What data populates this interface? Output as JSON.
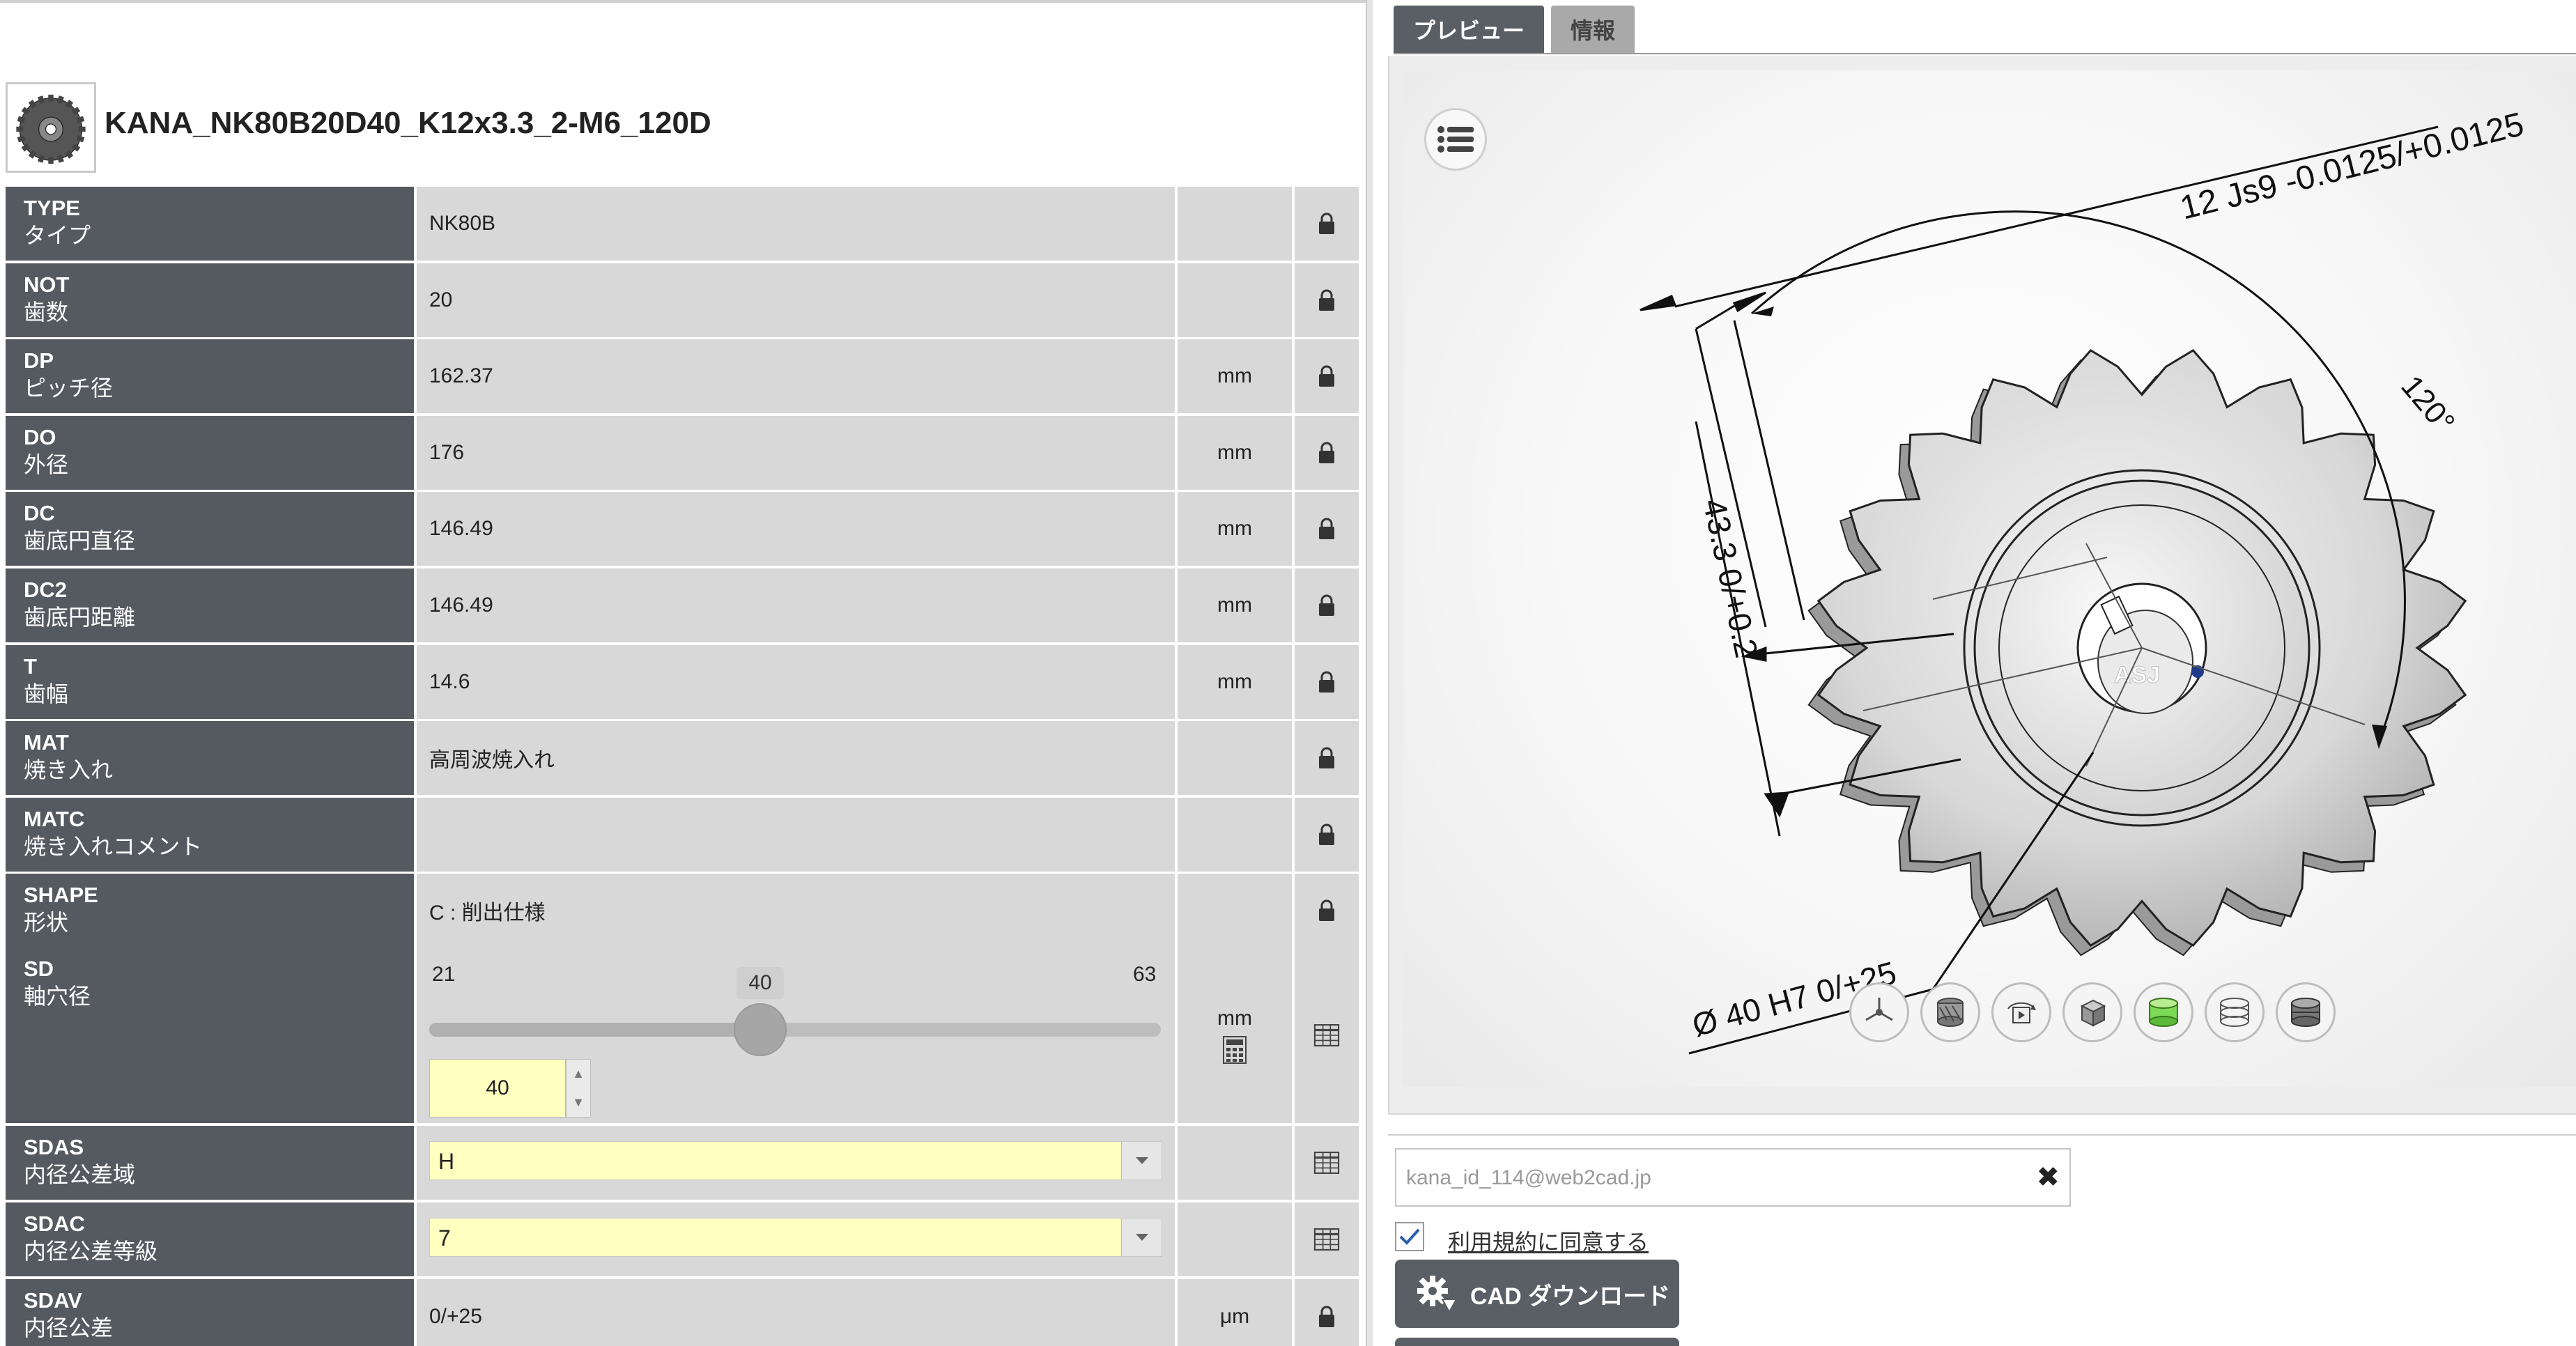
{
  "part": {
    "title": "KANA_NK80B20D40_K12x3.3_2-M6_120D",
    "thumbnail_icon": "sprocket-thumbnail-icon"
  },
  "params": [
    {
      "code": "TYPE",
      "jp": "タイプ",
      "value": "NK80B",
      "unit": "",
      "action_icon": "lock-icon"
    },
    {
      "code": "NOT",
      "jp": "歯数",
      "value": "20",
      "unit": "",
      "action_icon": "lock-icon"
    },
    {
      "code": "DP",
      "jp": "ピッチ径",
      "value": "162.37",
      "unit": "mm",
      "action_icon": "lock-icon"
    },
    {
      "code": "DO",
      "jp": "外径",
      "value": "176",
      "unit": "mm",
      "action_icon": "lock-icon"
    },
    {
      "code": "DC",
      "jp": "歯底円直径",
      "value": "146.49",
      "unit": "mm",
      "action_icon": "lock-icon"
    },
    {
      "code": "DC2",
      "jp": "歯底円距離",
      "value": "146.49",
      "unit": "mm",
      "action_icon": "lock-icon"
    },
    {
      "code": "T",
      "jp": "歯幅",
      "value": "14.6",
      "unit": "mm",
      "action_icon": "lock-icon"
    },
    {
      "code": "MAT",
      "jp": "焼き入れ",
      "value": "高周波焼入れ",
      "unit": "",
      "action_icon": "lock-icon"
    },
    {
      "code": "MATC",
      "jp": "焼き入れコメント",
      "value": "",
      "unit": "",
      "action_icon": "lock-icon"
    },
    {
      "code": "SHAPE",
      "jp": "形状",
      "value": "C : 削出仕様",
      "unit": "",
      "action_icon": "lock-icon"
    }
  ],
  "sd": {
    "code": "SD",
    "jp": "軸穴径",
    "min": "21",
    "max": "63",
    "current": "40",
    "input_value": "40",
    "unit": "mm",
    "calc_icon": "calculator-icon",
    "action_icon": "table-icon"
  },
  "selects": [
    {
      "code": "SDAS",
      "jp": "内径公差域",
      "value": "H",
      "action_icon": "table-icon"
    },
    {
      "code": "SDAC",
      "jp": "内径公差等級",
      "value": "7",
      "action_icon": "table-icon"
    }
  ],
  "sdav": {
    "code": "SDAV",
    "jp": "内径公差",
    "value": "0/+25",
    "unit": "μm",
    "action_icon": "lock-icon"
  },
  "tabs": {
    "preview": "プレビュー",
    "info": "情報"
  },
  "viewer": {
    "dimensions": {
      "keyway": "12 Js9 -0.0125/+0.0125",
      "angle": "120°",
      "key_height": "43.3 0/+0.2",
      "bore": "Ø 40 H7 0/+25"
    },
    "logo_text": "ASJ",
    "toolbar_icons": [
      "axis-view-icon",
      "section-view-icon",
      "rotate-view-icon",
      "iso-view-icon",
      "shaded-view-icon",
      "wireframe-view-icon",
      "solid-view-icon"
    ],
    "colors": {
      "highlight_green": "#7ed957"
    }
  },
  "download": {
    "email_placeholder": "kana_id_114@web2cad.jp",
    "agree_label": "利用規約に同意する",
    "agree_checked": true,
    "cad_button_label": "CAD ダウンロード"
  },
  "colors": {
    "header_gray": "#555a60",
    "cell_gray": "#d8d8d8",
    "input_yellow": "#ffffc0"
  }
}
